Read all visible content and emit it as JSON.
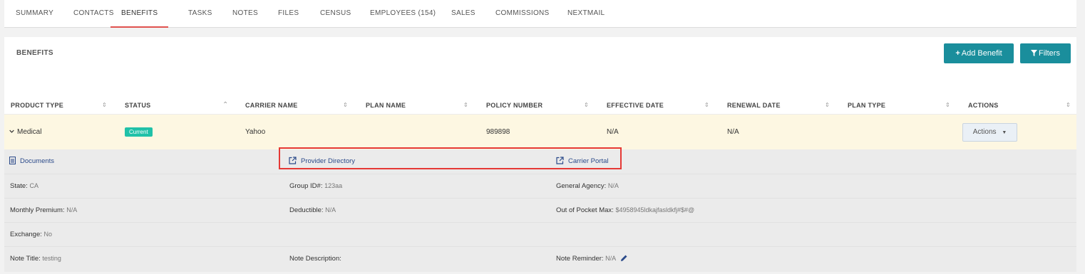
{
  "tabs": [
    {
      "label": "SUMMARY"
    },
    {
      "label": "CONTACTS"
    },
    {
      "label": "BENEFITS",
      "active": true
    },
    {
      "label": "TASKS"
    },
    {
      "label": "NOTES"
    },
    {
      "label": "FILES"
    },
    {
      "label": "CENSUS"
    },
    {
      "label": "EMPLOYEES (154)"
    },
    {
      "label": "SALES"
    },
    {
      "label": "COMMISSIONS"
    },
    {
      "label": "NEXTMAIL"
    }
  ],
  "section": {
    "title": "BENEFITS",
    "add_label": "Add Benefit",
    "filters_label": "Filters",
    "accent_color": "#1a8e9c"
  },
  "columns": [
    {
      "label": "PRODUCT TYPE"
    },
    {
      "label": "STATUS"
    },
    {
      "label": "CARRIER NAME"
    },
    {
      "label": "PLAN NAME"
    },
    {
      "label": "POLICY NUMBER"
    },
    {
      "label": "EFFECTIVE DATE"
    },
    {
      "label": "RENEWAL DATE"
    },
    {
      "label": "PLAN TYPE"
    },
    {
      "label": "ACTIONS"
    }
  ],
  "row": {
    "product_type": "Medical",
    "status": "Current",
    "carrier_name": "Yahoo",
    "plan_name": "",
    "policy_number": "989898",
    "effective_date": "N/A",
    "renewal_date": "N/A",
    "plan_type": "",
    "actions_label": "Actions"
  },
  "details": {
    "documents": "Documents",
    "provider_directory": "Provider Directory",
    "carrier_portal": "Carrier Portal",
    "state_label": "State:",
    "state_value": "CA",
    "group_id_label": "Group ID#:",
    "group_id_value": "123aa",
    "general_agency_label": "General Agency:",
    "general_agency_value": "N/A",
    "monthly_premium_label": "Monthly Premium:",
    "monthly_premium_value": "N/A",
    "deductible_label": "Deductible:",
    "deductible_value": "N/A",
    "oop_max_label": "Out of Pocket Max:",
    "oop_max_value": "$4958945ldkajfasldkfj#$#@",
    "exchange_label": "Exchange:",
    "exchange_value": "No",
    "note_title_label": "Note Title:",
    "note_title_value": "testing",
    "note_description_label": "Note Description:",
    "note_description_value": "",
    "note_reminder_label": "Note Reminder:",
    "note_reminder_value": "N/A"
  },
  "icons": {
    "sort": "sort-icon",
    "sort_up": "sort-up-icon",
    "chevron": "chevron-down-icon",
    "document": "document-icon",
    "external_link": "external-link-icon",
    "pencil": "pencil-icon",
    "plus": "plus-icon",
    "filter": "filter-icon"
  },
  "colors": {
    "active_tab_underline": "#e0524f",
    "status_badge": "#20c1a8",
    "row_highlight": "#fdf7e2",
    "callout_border": "#e53935"
  }
}
